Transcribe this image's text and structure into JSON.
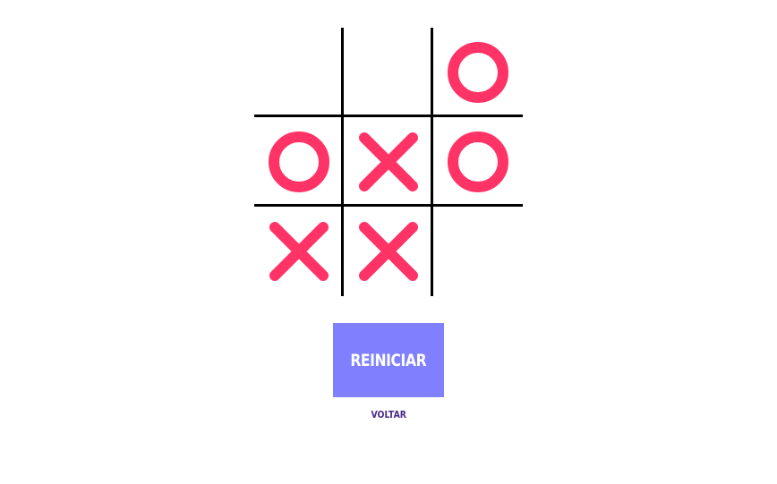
{
  "game": {
    "board": [
      [
        "",
        "",
        "O"
      ],
      [
        "O",
        "X",
        "O"
      ],
      [
        "X",
        "X",
        ""
      ]
    ],
    "mark_color": "#ff3366",
    "line_color": "#000000"
  },
  "controls": {
    "restart_label": "REINICIAR",
    "restart_color": "#8080ff",
    "back_label": "VOLTAR",
    "back_color": "#4b2a8a"
  }
}
